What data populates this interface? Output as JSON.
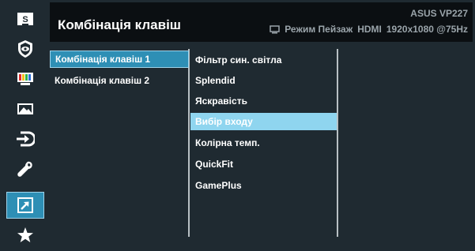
{
  "header": {
    "title": "Комбінація клавіш",
    "model": "ASUS  VP227",
    "mode": "Режим Пейзаж",
    "input": "HDMI",
    "resolution": "1920x1080 @75Hz"
  },
  "sidebar": {
    "items": [
      {
        "name": "splendid-icon",
        "selected": false
      },
      {
        "name": "blue-light-filter-icon",
        "selected": false
      },
      {
        "name": "color-icon",
        "selected": false
      },
      {
        "name": "image-icon",
        "selected": false
      },
      {
        "name": "input-select-icon",
        "selected": false
      },
      {
        "name": "system-setup-icon",
        "selected": false
      },
      {
        "name": "shortcut-icon",
        "selected": true
      },
      {
        "name": "favorite-icon",
        "selected": false
      }
    ]
  },
  "shortcut_list": [
    {
      "label": "Комбінація клавіш 1",
      "selected": true
    },
    {
      "label": "Комбінація клавіш 2",
      "selected": false
    }
  ],
  "function_list": [
    {
      "label": "Фільтр син. світла",
      "selected": false
    },
    {
      "label": "Splendid",
      "selected": false
    },
    {
      "label": "Яскравість",
      "selected": false
    },
    {
      "label": "Вибір входу",
      "selected": true
    },
    {
      "label": "Колірна темп.",
      "selected": false
    },
    {
      "label": "QuickFit",
      "selected": false
    },
    {
      "label": "GamePlus",
      "selected": false
    }
  ],
  "colors": {
    "background": "#1f2a31",
    "header": "#0b0f12",
    "accent": "#2e8fb5",
    "highlight": "#8fd5ef",
    "muted_text": "#9aa4aa"
  }
}
